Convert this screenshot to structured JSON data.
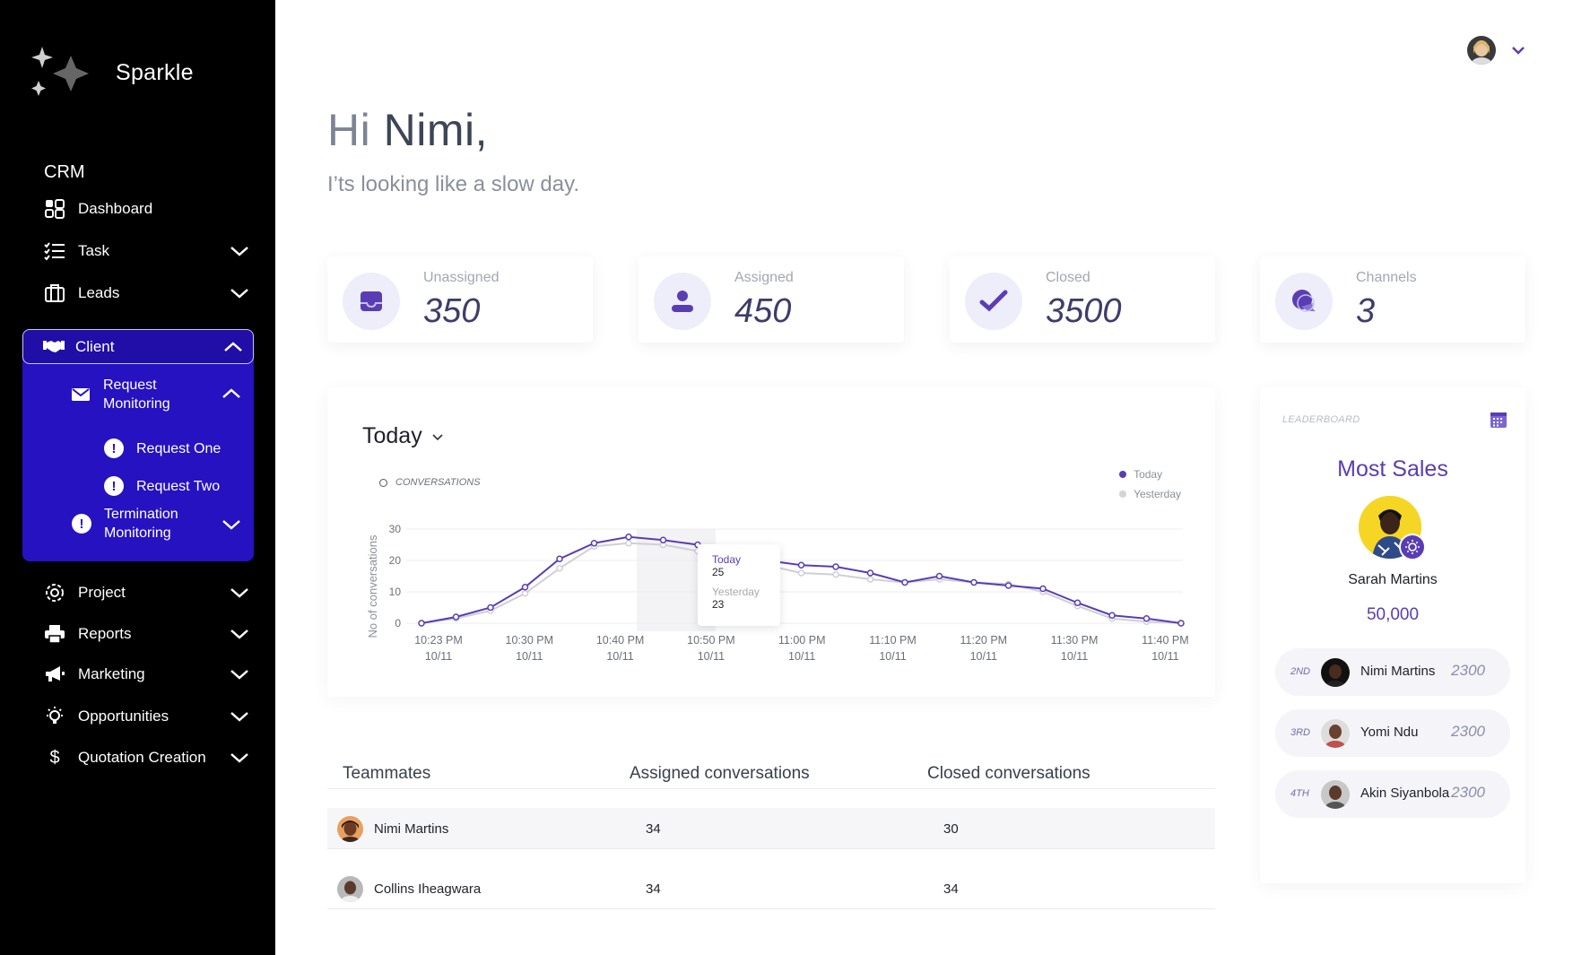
{
  "app": {
    "name": "Sparkle"
  },
  "sidebar": {
    "section": "CRM",
    "items": [
      {
        "label": "Dashboard",
        "icon": "dashboard-icon"
      },
      {
        "label": "Task",
        "icon": "task-list-icon"
      },
      {
        "label": "Leads",
        "icon": "briefcase-icon"
      },
      {
        "label": "Client",
        "icon": "handshake-icon"
      },
      {
        "label": "Project",
        "icon": "gear-icon"
      },
      {
        "label": "Reports",
        "icon": "printer-icon"
      },
      {
        "label": "Marketing",
        "icon": "megaphone-icon"
      },
      {
        "label": "Opportunities",
        "icon": "lightbulb-icon"
      },
      {
        "label": "Quotation Creation",
        "icon": "dollar-icon"
      }
    ],
    "client_sub": {
      "request_monitoring": "Request Monitoring",
      "request_one": "Request One",
      "request_two": "Request Two",
      "termination_monitoring": "Termination Monitoring"
    }
  },
  "header": {
    "hi": "Hi",
    "name": "Nimi,",
    "subtitle": "I’ts looking like a slow day."
  },
  "stats": [
    {
      "label": "Unassigned",
      "value": "350",
      "icon": "inbox-icon"
    },
    {
      "label": "Assigned",
      "value": "450",
      "icon": "user-icon"
    },
    {
      "label": "Closed",
      "value": "3500",
      "icon": "check-icon"
    },
    {
      "label": "Channels",
      "value": "3",
      "icon": "chat-bubbles-icon"
    }
  ],
  "chart": {
    "period": "Today",
    "legend_label": "CONVERSATIONS",
    "tooltip": {
      "today_label": "Today",
      "today_value": "25",
      "yesterday_label": "Yesterday",
      "yesterday_value": "23"
    }
  },
  "chart_data": {
    "type": "line",
    "ylabel": "No of conversations",
    "xlabel": "",
    "ylim": [
      0,
      30
    ],
    "yticks": [
      0,
      10,
      20,
      30
    ],
    "xticks": [
      "10:23 PM\n10/11",
      "10:30 PM\n10/11",
      "10:40 PM\n10/11",
      "10:50 PM\n10/11",
      "11:00 PM\n10/11",
      "11:10 PM\n10/11",
      "11:20 PM\n10/11",
      "11:30 PM\n10/11",
      "11:40 PM\n10/11"
    ],
    "legend": "top-right",
    "grid": true,
    "series": [
      {
        "name": "Today",
        "color": "#5a3db3",
        "values": [
          0,
          2,
          5,
          11.5,
          20.5,
          25.5,
          27.5,
          26.5,
          25,
          23,
          20,
          18.5,
          18,
          16,
          13,
          15,
          13,
          12,
          11,
          6.5,
          2.5,
          1.5,
          0
        ]
      },
      {
        "name": "Yesterday",
        "color": "#cfcfd6",
        "values": [
          0,
          1.5,
          4,
          9.5,
          17.5,
          24.5,
          25.5,
          25,
          23,
          20,
          18.5,
          16,
          15.5,
          14,
          13,
          14,
          13,
          12.5,
          10,
          5.5,
          1.5,
          0.5,
          0
        ]
      }
    ]
  },
  "table": {
    "headers": [
      "Teammates",
      "Assigned conversations",
      "Closed conversations"
    ],
    "rows": [
      {
        "name": "Nimi Martins",
        "assigned": "34",
        "closed": "30"
      },
      {
        "name": "Collins Iheagwara",
        "assigned": "34",
        "closed": "34"
      }
    ]
  },
  "leaderboard": {
    "title": "LEADERBOARD",
    "heading": "Most Sales",
    "winner": {
      "name": "Sarah Martins",
      "score": "50,000"
    },
    "others": [
      {
        "rank": "2ND",
        "name": "Nimi Martins",
        "value": "2300"
      },
      {
        "rank": "3RD",
        "name": "Yomi Ndu",
        "value": "2300"
      },
      {
        "rank": "4TH",
        "name": "Akin Siyanbola",
        "value": "2300"
      }
    ]
  },
  "colors": {
    "sidebar_bg": "#000000",
    "client_bg": "#2612c0",
    "accent": "#5a3db3",
    "yesterday": "#cfcfd6"
  }
}
